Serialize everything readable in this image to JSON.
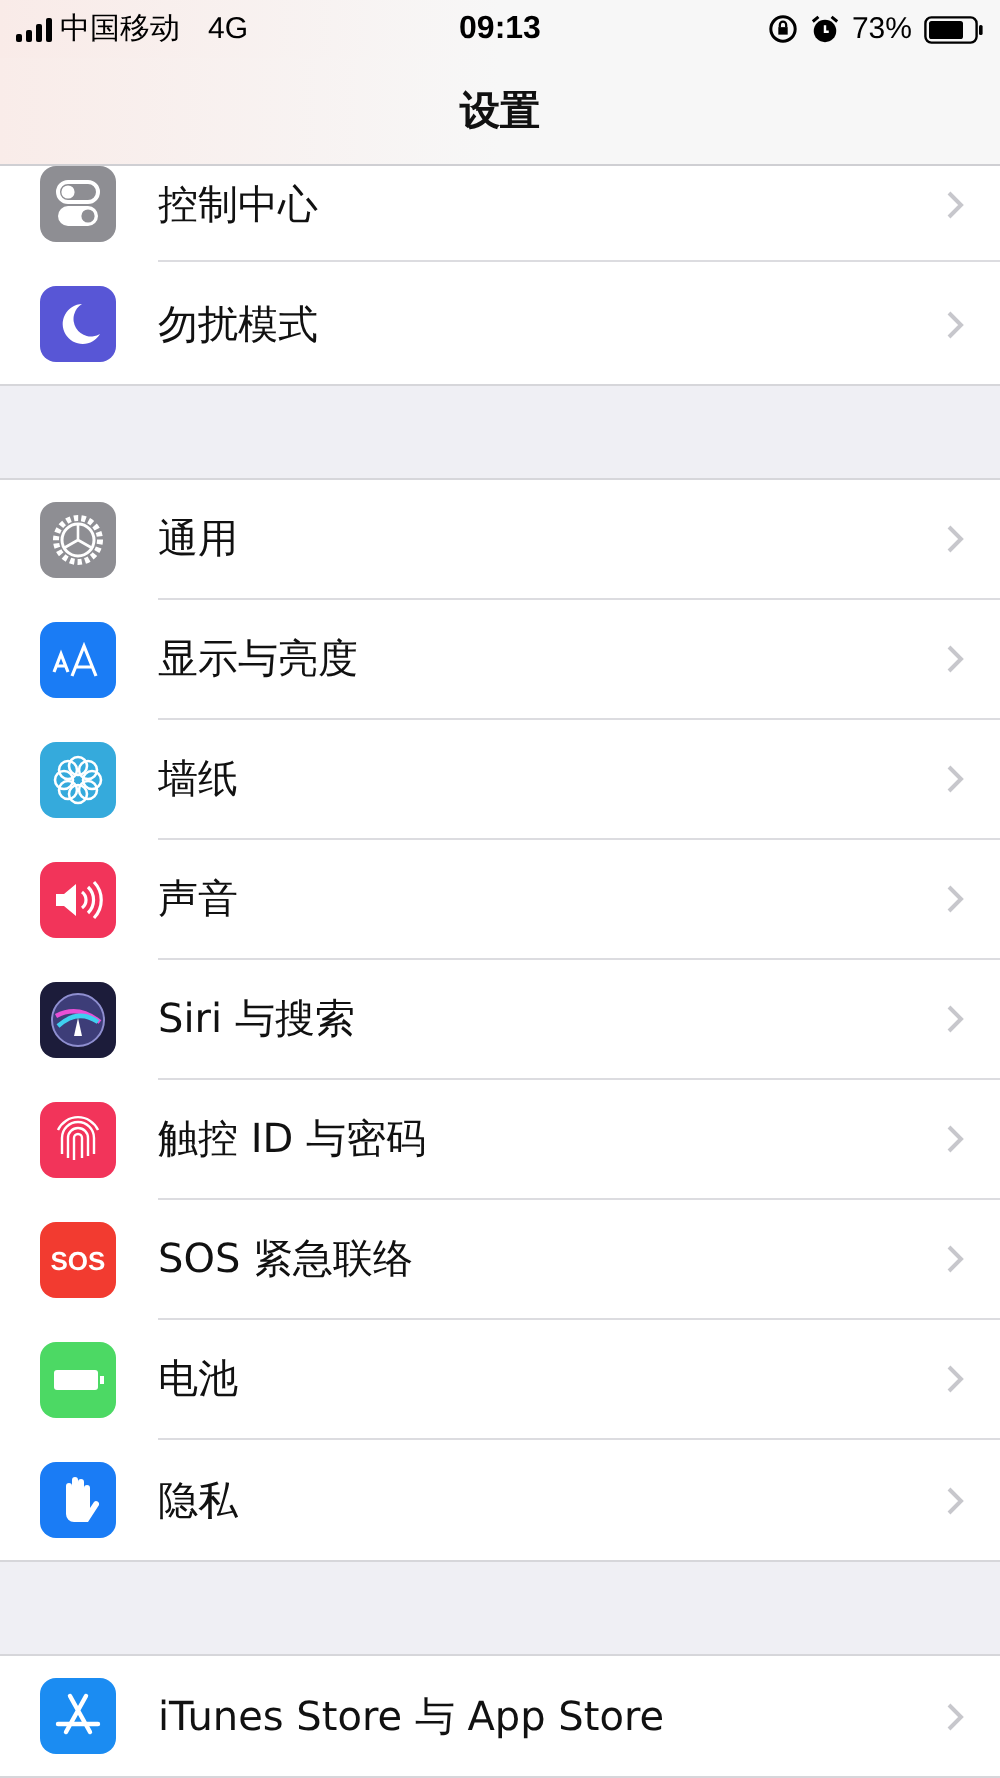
{
  "status_bar": {
    "carrier": "中国移动",
    "network": "4G",
    "time": "09:13",
    "battery": "73%"
  },
  "nav_bar": {
    "title": "设置"
  },
  "groups": [
    {
      "items": [
        {
          "label": "控制中心",
          "kind": "toggles"
        },
        {
          "label": "勿扰模式",
          "kind": "moon"
        }
      ]
    },
    {
      "items": [
        {
          "label": "通用",
          "kind": "gear"
        },
        {
          "label": "显示与亮度",
          "kind": "letters"
        },
        {
          "label": "墙纸",
          "kind": "flower"
        },
        {
          "label": "声音",
          "kind": "speaker"
        },
        {
          "label": "Siri 与搜索",
          "kind": "siri"
        },
        {
          "label": "触控 ID 与密码",
          "kind": "fingerprint"
        },
        {
          "label": "SOS 紧急联络",
          "kind": "sos",
          "icon_text": "SOS"
        },
        {
          "label": "电池",
          "kind": "battery"
        },
        {
          "label": "隐私",
          "kind": "hand"
        }
      ]
    },
    {
      "items": [
        {
          "label": "iTunes Store 与 App Store",
          "kind": "appstore"
        }
      ]
    }
  ]
}
